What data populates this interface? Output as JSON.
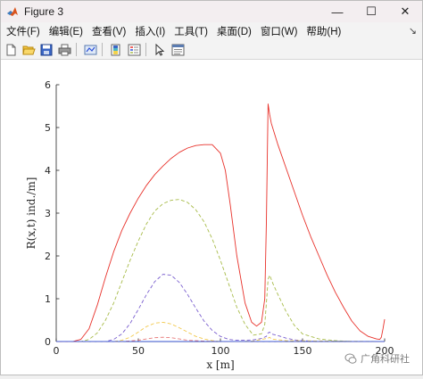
{
  "window": {
    "title": "Figure 3",
    "minimize_glyph": "—",
    "maximize_glyph": "☐",
    "close_glyph": "✕"
  },
  "menubar": {
    "items": [
      "文件(F)",
      "编辑(E)",
      "查看(V)",
      "插入(I)",
      "工具(T)",
      "桌面(D)",
      "窗口(W)",
      "帮助(H)"
    ],
    "pin_glyph": "↘"
  },
  "toolbar": {
    "icons": [
      "new-figure-icon",
      "open-file-icon",
      "save-icon",
      "print-icon",
      "link-plot-icon",
      "insert-colorbar-icon",
      "insert-legend-icon",
      "edit-plot-arrow-icon",
      "property-inspector-icon"
    ]
  },
  "watermark": {
    "text": "广角科研社"
  },
  "chart_data": {
    "type": "line",
    "xlabel": "x [m]",
    "ylabel": "R(x,t)  ind./m]",
    "xlim": [
      0,
      200
    ],
    "ylim": [
      0,
      6
    ],
    "xticks": [
      "0",
      "50",
      "100",
      "150",
      "200"
    ],
    "yticks": [
      "0",
      "1",
      "2",
      "3",
      "4",
      "5",
      "6"
    ],
    "grid": false,
    "series": [
      {
        "style": "solid",
        "color": "#e8312a",
        "x": [
          0,
          10,
          15,
          20,
          25,
          30,
          35,
          40,
          45,
          50,
          55,
          60,
          65,
          70,
          75,
          80,
          85,
          90,
          95,
          100,
          103,
          106,
          110,
          115,
          119,
          122,
          125,
          127,
          128,
          129,
          130,
          131,
          135,
          140,
          145,
          150,
          155,
          160,
          165,
          170,
          175,
          180,
          185,
          190,
          195,
          197,
          198,
          199,
          200
        ],
        "y": [
          0,
          0,
          0.05,
          0.3,
          0.85,
          1.5,
          2.1,
          2.6,
          3.0,
          3.35,
          3.65,
          3.9,
          4.1,
          4.28,
          4.42,
          4.52,
          4.58,
          4.6,
          4.6,
          4.4,
          4.0,
          3.2,
          2.0,
          0.9,
          0.45,
          0.36,
          0.45,
          1.0,
          2.8,
          5.55,
          5.3,
          5.1,
          4.6,
          4.05,
          3.5,
          2.95,
          2.45,
          2.0,
          1.55,
          1.15,
          0.8,
          0.48,
          0.25,
          0.12,
          0.06,
          0.05,
          0.1,
          0.3,
          0.52
        ]
      },
      {
        "style": "dashed",
        "color": "#a7bb48",
        "x": [
          0,
          15,
          20,
          25,
          30,
          35,
          40,
          45,
          50,
          55,
          60,
          65,
          70,
          75,
          80,
          85,
          90,
          95,
          100,
          105,
          110,
          115,
          120,
          125,
          127,
          128,
          129,
          130,
          132,
          135,
          140,
          145,
          150,
          160,
          170,
          180,
          190,
          200
        ],
        "y": [
          0,
          0,
          0.05,
          0.2,
          0.5,
          0.9,
          1.4,
          1.9,
          2.35,
          2.75,
          3.05,
          3.22,
          3.3,
          3.32,
          3.25,
          3.08,
          2.8,
          2.4,
          1.9,
          1.35,
          0.8,
          0.4,
          0.15,
          0.18,
          0.4,
          0.9,
          1.45,
          1.55,
          1.35,
          1.1,
          0.7,
          0.38,
          0.18,
          0.06,
          0.02,
          0,
          0,
          0
        ]
      },
      {
        "style": "dashed",
        "color": "#7a5fcf",
        "x": [
          0,
          30,
          35,
          40,
          45,
          50,
          55,
          60,
          65,
          70,
          75,
          80,
          85,
          90,
          95,
          100,
          105,
          110,
          115,
          120,
          125,
          128,
          129,
          130,
          131,
          135,
          140,
          145,
          150,
          160,
          200
        ],
        "y": [
          0,
          0,
          0.05,
          0.18,
          0.42,
          0.75,
          1.1,
          1.4,
          1.57,
          1.55,
          1.38,
          1.1,
          0.78,
          0.48,
          0.26,
          0.12,
          0.05,
          0.03,
          0.03,
          0.04,
          0.07,
          0.12,
          0.2,
          0.22,
          0.18,
          0.14,
          0.08,
          0.04,
          0.02,
          0,
          0
        ]
      },
      {
        "style": "dashed",
        "color": "#f2c94c",
        "x": [
          0,
          35,
          40,
          45,
          50,
          55,
          60,
          65,
          70,
          75,
          80,
          85,
          90,
          95,
          100,
          110,
          120,
          129,
          130,
          131,
          140,
          200
        ],
        "y": [
          0,
          0,
          0.03,
          0.1,
          0.22,
          0.35,
          0.43,
          0.45,
          0.41,
          0.32,
          0.22,
          0.12,
          0.06,
          0.02,
          0,
          0,
          0.01,
          0.08,
          0.1,
          0.06,
          0.02,
          0
        ]
      },
      {
        "style": "dashed",
        "color": "#e87a7a",
        "x": [
          0,
          40,
          50,
          55,
          60,
          65,
          70,
          75,
          80,
          90,
          100,
          200
        ],
        "y": [
          0,
          0,
          0.03,
          0.06,
          0.09,
          0.1,
          0.09,
          0.06,
          0.03,
          0.01,
          0,
          0
        ]
      },
      {
        "style": "solid",
        "color": "#2b4fd8",
        "x": [
          0,
          200
        ],
        "y": [
          0.003,
          0.003
        ]
      }
    ]
  }
}
